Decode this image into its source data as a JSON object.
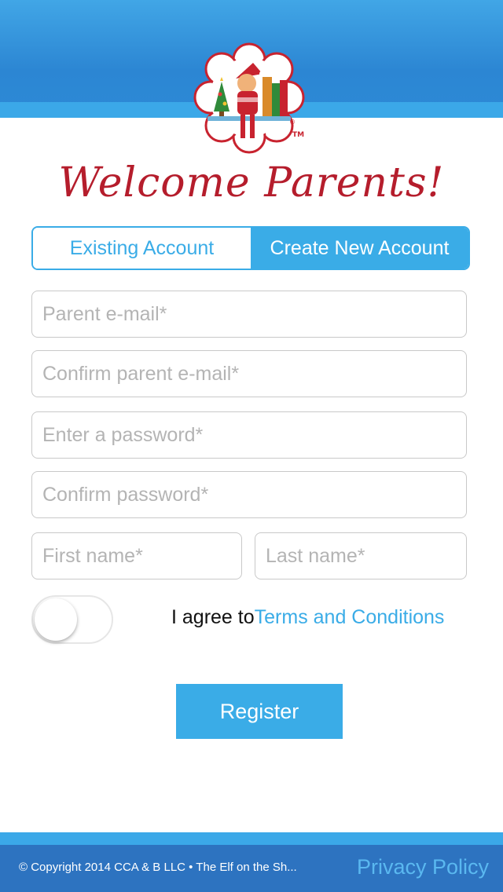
{
  "header": {
    "welcome_text": "Welcome Parents!"
  },
  "logo": {
    "trademark": "TM",
    "registered": "®"
  },
  "tabs": [
    {
      "label": "Existing Account",
      "active": false
    },
    {
      "label": "Create New Account",
      "active": true
    }
  ],
  "form": {
    "parent_email": {
      "placeholder": "Parent e-mail*",
      "value": ""
    },
    "confirm_email": {
      "placeholder": "Confirm parent e-mail*",
      "value": ""
    },
    "password": {
      "placeholder": "Enter a password*",
      "value": ""
    },
    "confirm_password": {
      "placeholder": "Confirm password*",
      "value": ""
    },
    "first_name": {
      "placeholder": "First name*",
      "value": ""
    },
    "last_name": {
      "placeholder": "Last name*",
      "value": ""
    },
    "agree_prefix": "I agree to",
    "terms_link": "Terms and Conditions",
    "agree_toggle_on": false,
    "register_label": "Register"
  },
  "footer": {
    "copyright": "© Copyright 2014 CCA & B LLC • The Elf on the Sh...",
    "privacy_link": "Privacy Policy"
  },
  "colors": {
    "accent": "#3aace7",
    "header_blue": "#2c86d3",
    "footer_blue": "#2d73c0",
    "welcome_red": "#b51d2c"
  }
}
